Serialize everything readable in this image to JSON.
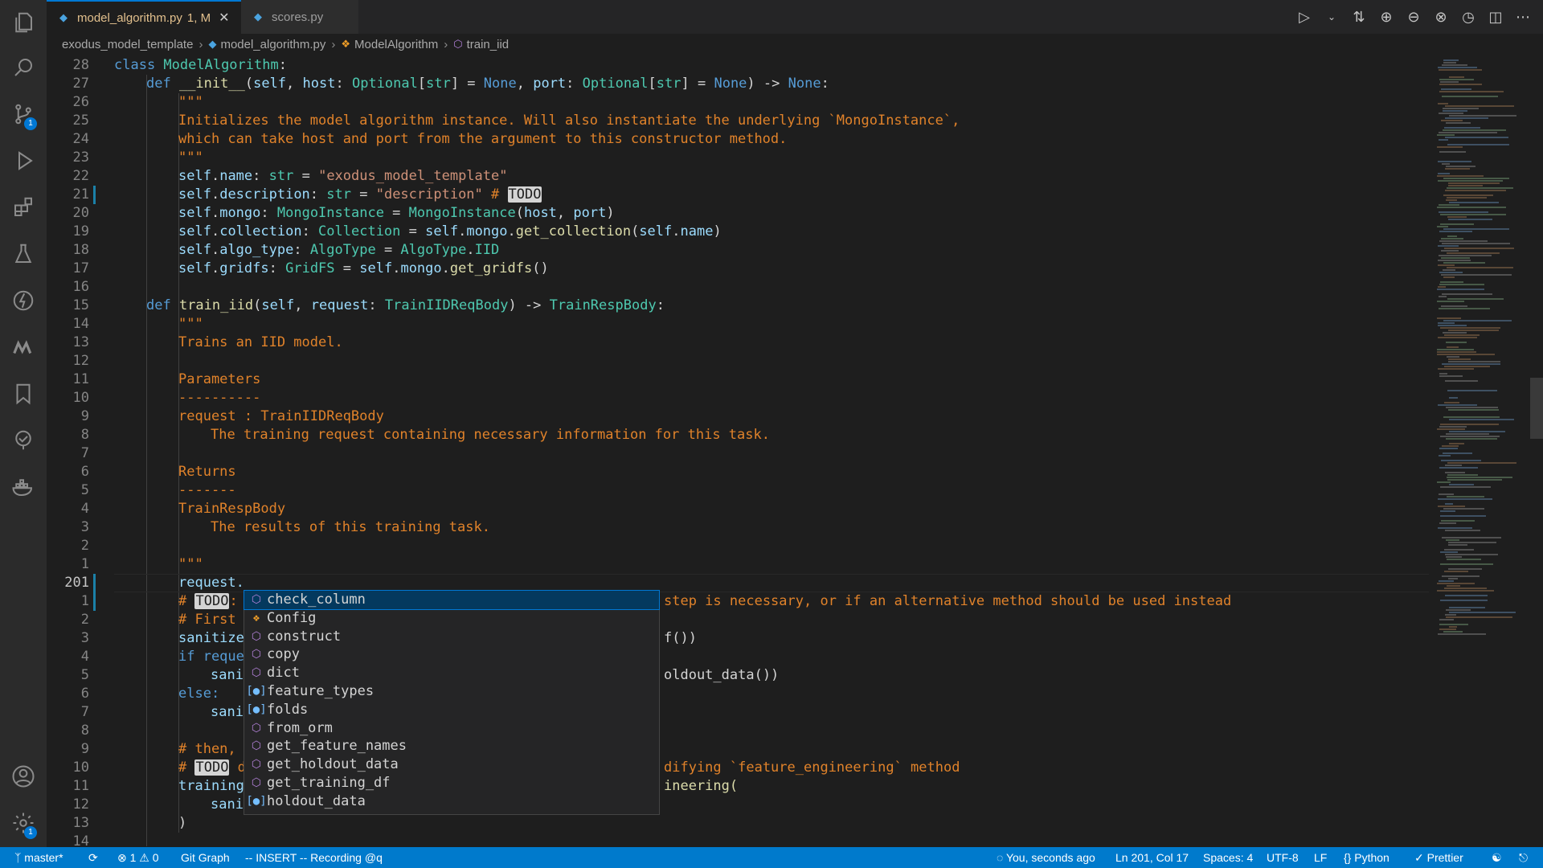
{
  "activity_bar": {
    "source_control_badge": "1",
    "settings_badge": "1"
  },
  "tabs": [
    {
      "label": "model_algorithm.py",
      "status": "1, M",
      "active": true
    },
    {
      "label": "scores.py",
      "active": false
    }
  ],
  "breadcrumb": {
    "folder": "exodus_model_template",
    "file": "model_algorithm.py",
    "class": "ModelAlgorithm",
    "method": "train_iid"
  },
  "editor": {
    "line_numbers": [
      "28",
      "27",
      "26",
      "25",
      "24",
      "23",
      "22",
      "21",
      "20",
      "19",
      "18",
      "17",
      "16",
      "15",
      "14",
      "13",
      "12",
      "11",
      "10",
      "9",
      "8",
      "7",
      "6",
      "5",
      "4",
      "3",
      "2",
      "1",
      "201",
      "1",
      "2",
      "3",
      "4",
      "5",
      "6",
      "7",
      "8",
      "9",
      "10",
      "11",
      "12",
      "13",
      "14"
    ],
    "current_line_index": 28,
    "code": {
      "l0": [
        "class ",
        "ModelAlgorithm",
        ":"
      ],
      "l1": [
        "def ",
        "__init__",
        "(",
        "self",
        ", ",
        "host",
        ": ",
        "Optional",
        "[",
        "str",
        "] = ",
        "None",
        ", ",
        "port",
        ": ",
        "Optional",
        "[",
        "str",
        "] = ",
        "None",
        ") -> ",
        "None",
        ":"
      ],
      "l2": "\"\"\"",
      "l3": "Initializes the model algorithm instance. Will also instantiate the underlying `MongoInstance`,",
      "l4": "which can take host and port from the argument to this constructor method.",
      "l5": "\"\"\"",
      "l6": [
        "self",
        ".",
        "name",
        ": ",
        "str",
        " = ",
        "\"exodus_model_template\""
      ],
      "l7": [
        "self",
        ".",
        "description",
        ": ",
        "str",
        " = ",
        "\"description\"",
        " # ",
        "TODO"
      ],
      "l8": [
        "self",
        ".",
        "mongo",
        ": ",
        "MongoInstance",
        " = ",
        "MongoInstance",
        "(",
        "host",
        ", ",
        "port",
        ")"
      ],
      "l9": [
        "self",
        ".",
        "collection",
        ": ",
        "Collection",
        " = ",
        "self",
        ".",
        "mongo",
        ".",
        "get_collection",
        "(",
        "self",
        ".",
        "name",
        ")"
      ],
      "l10": [
        "self",
        ".",
        "algo_type",
        ": ",
        "AlgoType",
        " = ",
        "AlgoType",
        ".",
        "IID"
      ],
      "l11": [
        "self",
        ".",
        "gridfs",
        ": ",
        "GridFS",
        " = ",
        "self",
        ".",
        "mongo",
        ".",
        "get_gridfs",
        "()"
      ],
      "l13": [
        "def ",
        "train_iid",
        "(",
        "self",
        ", ",
        "request",
        ": ",
        "TrainIIDReqBody",
        ") -> ",
        "TrainRespBody",
        ":"
      ],
      "l14": "\"\"\"",
      "l15": "Trains an IID model.",
      "l17": "Parameters",
      "l18": "----------",
      "l19": "request : TrainIIDReqBody",
      "l20": "The training request containing necessary information for this task.",
      "l22": "Returns",
      "l23": "-------",
      "l24": "TrainRespBody",
      "l25": "The results of this training task.",
      "l27": "\"\"\"",
      "l28": "request.",
      "l29a": "# ",
      "l29b": "TODO",
      "l29c": ":",
      "l29d": "step is necessary, or if an alternative method should be used instead",
      "l30": "# First",
      "l31a": "sanitize",
      "l31b": "f())",
      "l32": "if reque",
      "l33a": "sani",
      "l33b": "oldout_data())",
      "l34": "else:",
      "l35": "sani",
      "l37": "# then,",
      "l38a": "# ",
      "l38b": "TODO",
      "l38c": " d",
      "l38d": "difying `feature_engineering` method",
      "l39a": "training",
      "l39b": "ineering(",
      "l40": "sani",
      "l41": ")"
    }
  },
  "suggestions": [
    {
      "label": "check_column",
      "kind": "method",
      "icon": "cube-icon"
    },
    {
      "label": "Config",
      "kind": "class",
      "icon": "class-icon"
    },
    {
      "label": "construct",
      "kind": "method",
      "icon": "cube-icon"
    },
    {
      "label": "copy",
      "kind": "method",
      "icon": "cube-icon"
    },
    {
      "label": "dict",
      "kind": "method",
      "icon": "cube-icon"
    },
    {
      "label": "feature_types",
      "kind": "field",
      "icon": "field-icon"
    },
    {
      "label": "folds",
      "kind": "field",
      "icon": "field-icon"
    },
    {
      "label": "from_orm",
      "kind": "method",
      "icon": "cube-icon"
    },
    {
      "label": "get_feature_names",
      "kind": "method",
      "icon": "cube-icon"
    },
    {
      "label": "get_holdout_data",
      "kind": "method",
      "icon": "cube-icon"
    },
    {
      "label": "get_training_df",
      "kind": "method",
      "icon": "cube-icon"
    },
    {
      "label": "holdout_data",
      "kind": "field",
      "icon": "field-icon"
    }
  ],
  "status_bar": {
    "branch": "master*",
    "errors": "1",
    "warnings": "0",
    "git_graph": "Git Graph",
    "mode": "-- INSERT --",
    "recording": "Recording @q",
    "blame": "You, seconds ago",
    "position": "Ln 201, Col 17",
    "spaces": "Spaces: 4",
    "encoding": "UTF-8",
    "eol": "LF",
    "language": "Python",
    "formatter": "Prettier"
  },
  "colors": {
    "accent": "#007acc",
    "keyword": "#569cd6",
    "class": "#4ec9b0",
    "function": "#dcdcaa",
    "variable": "#9cdcfe",
    "string": "#ce9178",
    "comment": "#e0822a"
  }
}
